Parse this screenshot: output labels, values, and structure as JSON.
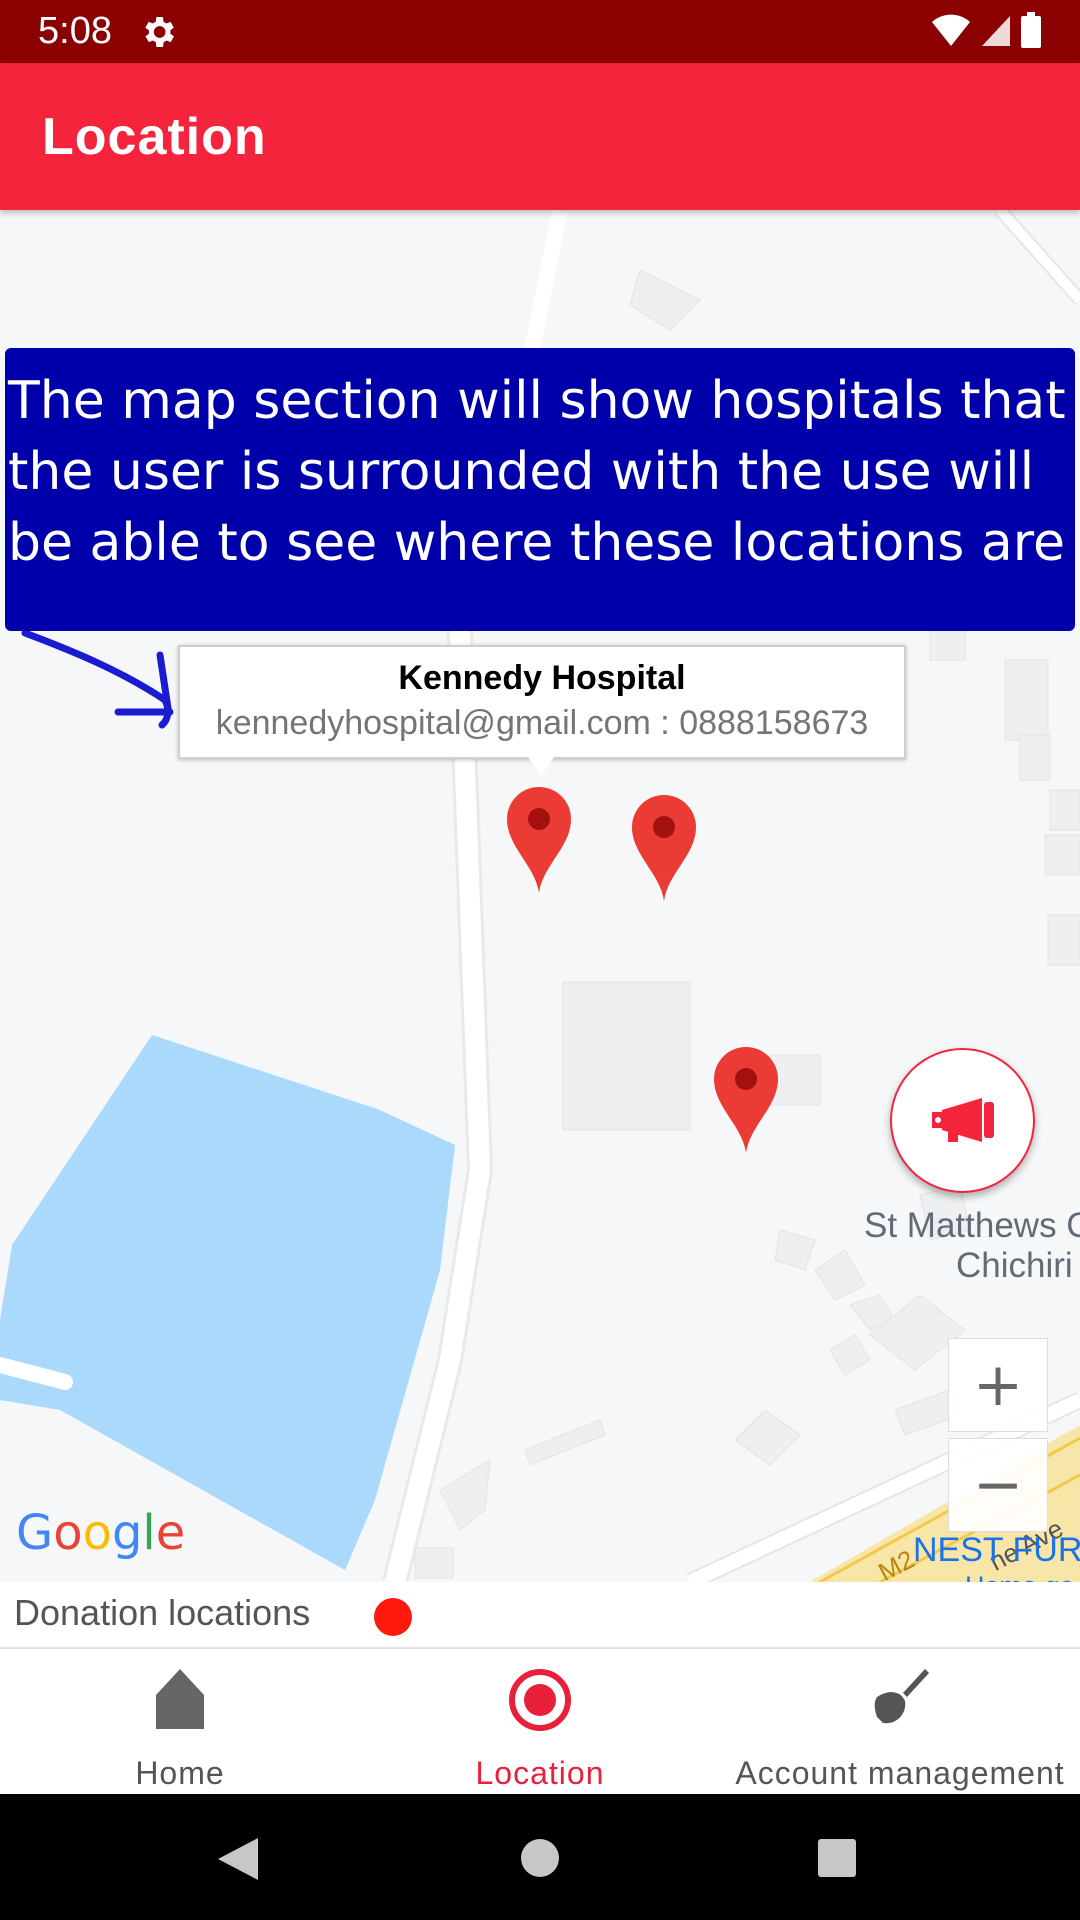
{
  "status_bar": {
    "time": "5:08"
  },
  "app_bar": {
    "title": "Location"
  },
  "banner": {
    "text": "The map section will show hospitals that the user is surrounded with the use will be able to see where these locations are"
  },
  "info_window": {
    "title": "Kennedy Hospital",
    "subtitle": "kennedyhospital@gmail.com : 0888158673"
  },
  "map": {
    "place_label_line1": "St Matthews C",
    "place_label_line2": "Chichiri",
    "business_label": "NEST FURI",
    "business_sub": "Home go",
    "road_label_1": "M2",
    "road_label_2": "ne Ave",
    "zoom_in": "+",
    "zoom_out": "−",
    "attribution": "Google"
  },
  "legend": {
    "label": "Donation locations",
    "dot_color": "#ff1a0d"
  },
  "bottom_nav": {
    "items": [
      {
        "label": "Home",
        "icon": "home-icon"
      },
      {
        "label": "Location",
        "icon": "location-radio-icon",
        "active": true
      },
      {
        "label": "Account management",
        "icon": "brush-icon"
      }
    ]
  },
  "colors": {
    "accent": "#f4243c",
    "status_bar": "#8b0000",
    "banner": "#0000aa"
  }
}
